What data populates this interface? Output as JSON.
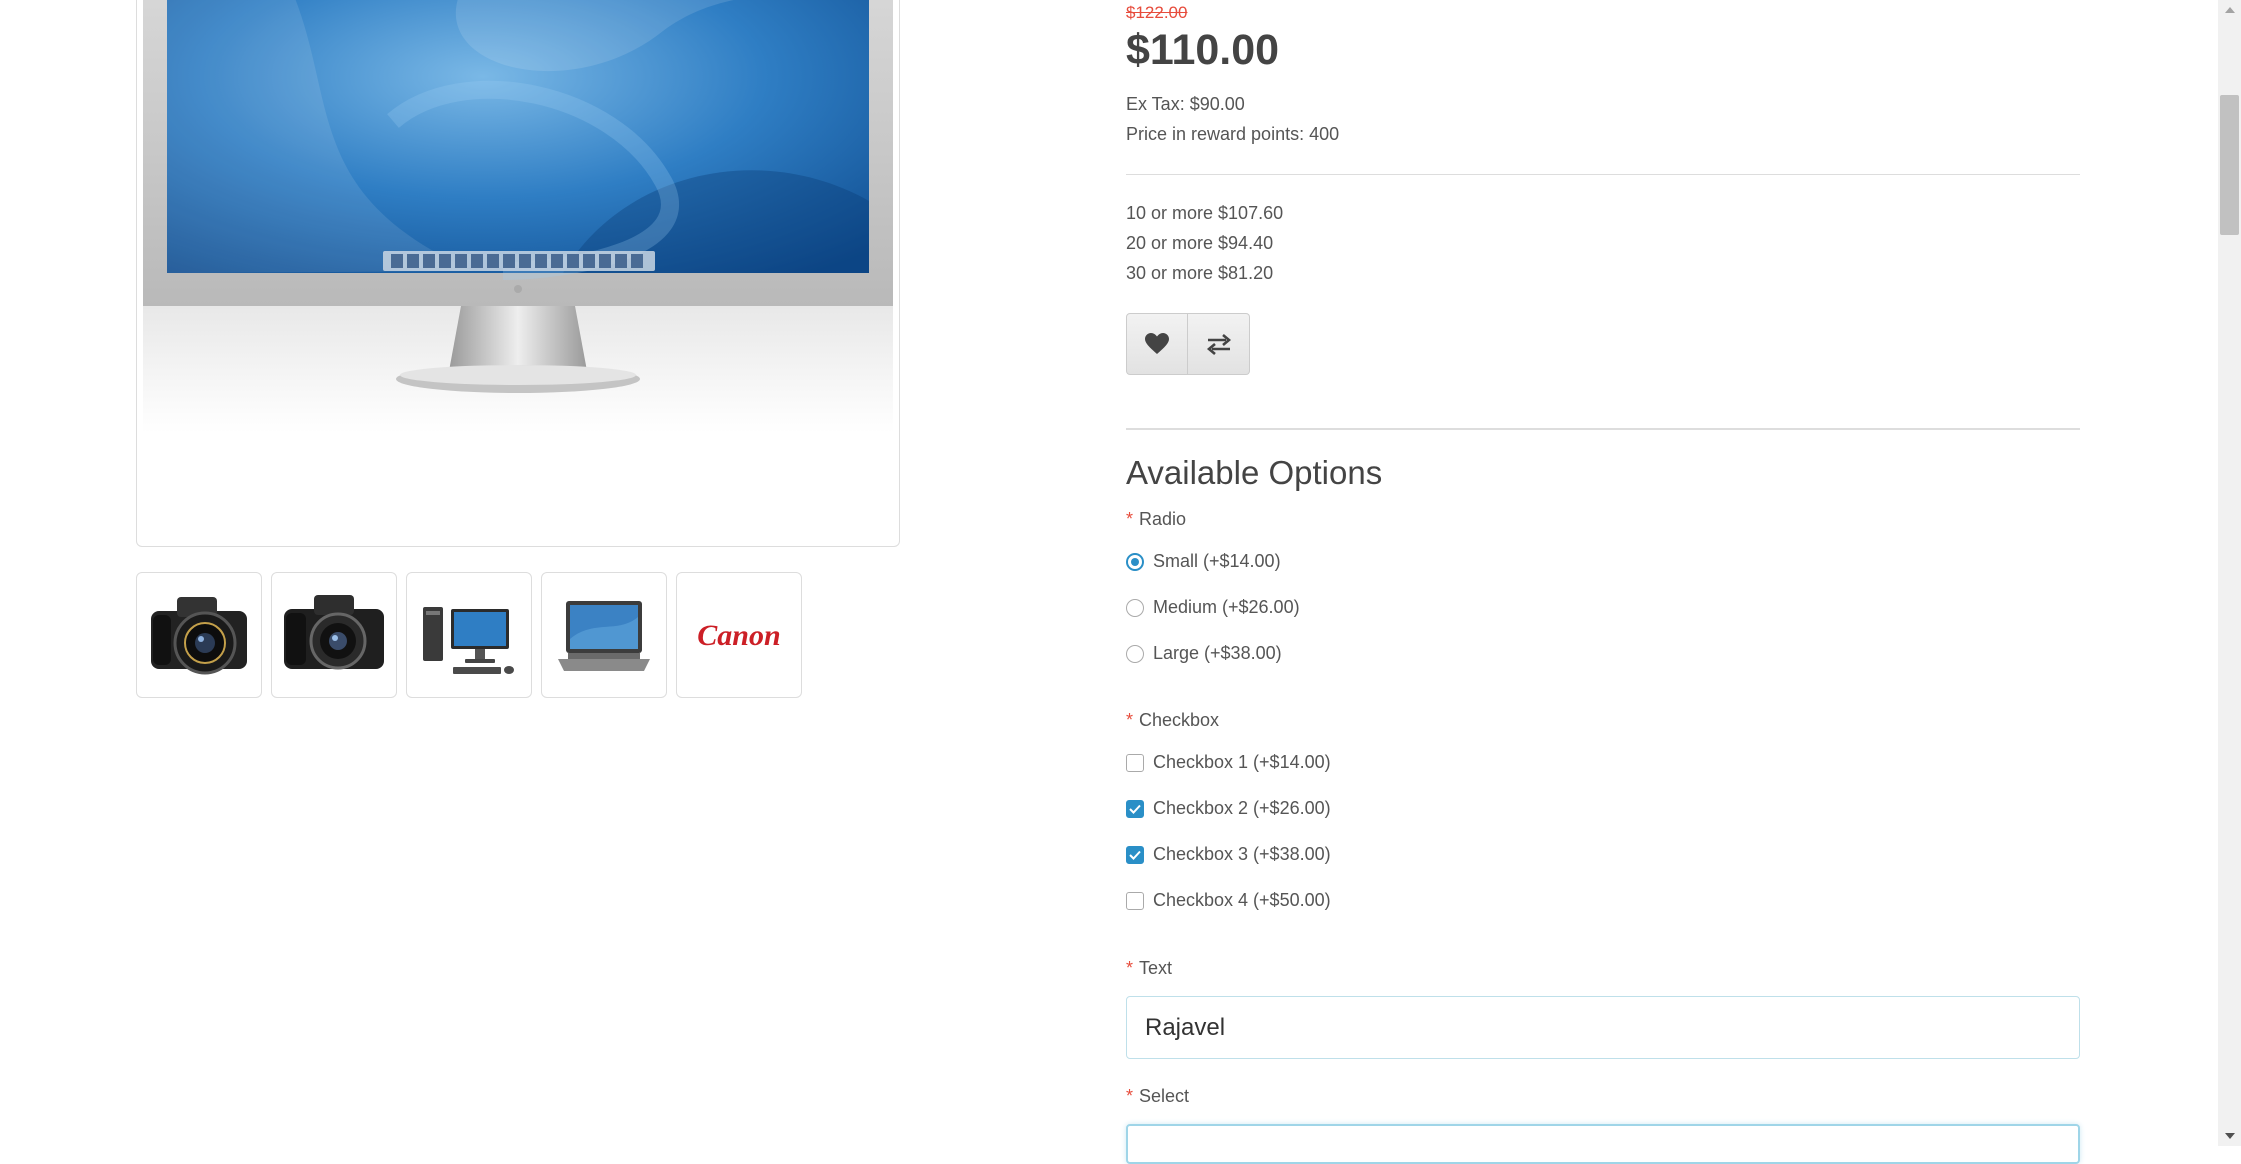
{
  "product": {
    "old_price": "$122.00",
    "price": "$110.00",
    "ex_tax": "Ex Tax: $90.00",
    "reward_points": "Price in reward points: 400",
    "discounts": [
      "10 or more $107.60",
      "20 or more $94.40",
      "30 or more $81.20"
    ]
  },
  "actions": {
    "wishlist_icon": "heart-icon",
    "compare_icon": "exchange-icon"
  },
  "thumbnails": [
    "camera-eos-5d",
    "camera-eos",
    "desktop-computer",
    "laptop",
    "canon-logo"
  ],
  "canon_logo_text": "Canon",
  "options": {
    "heading": "Available Options",
    "required_mark": "*",
    "radio": {
      "label": "Radio",
      "items": [
        {
          "label": "Small (+$14.00)",
          "checked": true
        },
        {
          "label": "Medium (+$26.00)",
          "checked": false
        },
        {
          "label": "Large (+$38.00)",
          "checked": false
        }
      ]
    },
    "checkbox": {
      "label": "Checkbox",
      "items": [
        {
          "label": "Checkbox 1 (+$14.00)",
          "checked": false
        },
        {
          "label": "Checkbox 2 (+$26.00)",
          "checked": true
        },
        {
          "label": "Checkbox 3 (+$38.00)",
          "checked": true
        },
        {
          "label": "Checkbox 4 (+$50.00)",
          "checked": false
        }
      ]
    },
    "text": {
      "label": "Text",
      "value": "Rajavel"
    },
    "select": {
      "label": "Select"
    }
  },
  "colors": {
    "accent": "#2a8fc7",
    "old_price": "#e74c3c",
    "required": "#e74c3c"
  }
}
